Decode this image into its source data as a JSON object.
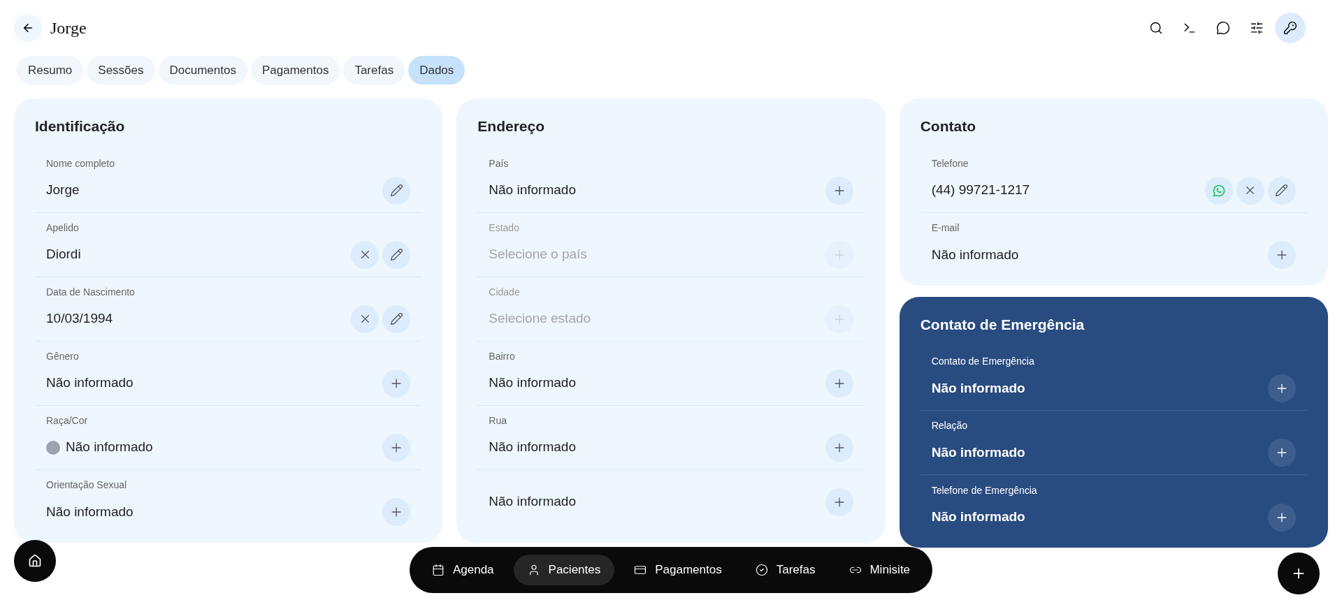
{
  "header": {
    "title": "Jorge",
    "tools": [
      {
        "kind": "search",
        "selected": false
      },
      {
        "kind": "terminal",
        "selected": false
      },
      {
        "kind": "chat",
        "selected": false
      },
      {
        "kind": "sliders",
        "selected": false
      },
      {
        "kind": "key",
        "selected": true
      }
    ]
  },
  "tabs": [
    {
      "label": "Resumo",
      "selected": false
    },
    {
      "label": "Sessões",
      "selected": false
    },
    {
      "label": "Documentos",
      "selected": false
    },
    {
      "label": "Pagamentos",
      "selected": false
    },
    {
      "label": "Tarefas",
      "selected": false
    },
    {
      "label": "Dados",
      "selected": true
    }
  ],
  "cards": [
    {
      "title": "Identificação",
      "kind": "light",
      "fields": [
        {
          "label": "Nome completo",
          "value": "Jorge",
          "disabled": false,
          "actions": [
            {
              "kind": "edit"
            }
          ]
        },
        {
          "label": "Apelido",
          "value": "Diordi",
          "disabled": false,
          "actions": [
            {
              "kind": "clear"
            },
            {
              "kind": "edit"
            }
          ]
        },
        {
          "label": "Data de Nascimento",
          "value": "10/03/1994",
          "disabled": false,
          "actions": [
            {
              "kind": "clear"
            },
            {
              "kind": "edit"
            }
          ]
        },
        {
          "label": "Gênero",
          "value": "Não informado",
          "disabled": false,
          "actions": [
            {
              "kind": "add"
            }
          ]
        },
        {
          "label": "Raça/Cor",
          "value": "Não informado",
          "disabled": false,
          "color": "#9ca3af",
          "actions": [
            {
              "kind": "add"
            }
          ]
        },
        {
          "label": "Orientação Sexual",
          "value": "Não informado",
          "disabled": false,
          "actions": [
            {
              "kind": "add"
            }
          ]
        }
      ]
    },
    {
      "title": "Endereço",
      "kind": "light",
      "fields": [
        {
          "label": "País",
          "value": "Não informado",
          "disabled": false,
          "actions": [
            {
              "kind": "add"
            }
          ]
        },
        {
          "label": "Estado",
          "placeholder": "Selecione o país",
          "disabled": true,
          "actions": [
            {
              "kind": "add"
            }
          ]
        },
        {
          "label": "Cidade",
          "placeholder": "Selecione estado",
          "disabled": true,
          "actions": [
            {
              "kind": "add"
            }
          ]
        },
        {
          "label": "Bairro",
          "value": "Não informado",
          "disabled": false,
          "actions": [
            {
              "kind": "add"
            }
          ]
        },
        {
          "label": "Rua",
          "value": "Não informado",
          "disabled": false,
          "actions": [
            {
              "kind": "add"
            }
          ]
        },
        {
          "value": "Não informado",
          "disabled": false,
          "actions": [
            {
              "kind": "add"
            }
          ]
        }
      ]
    },
    {
      "title": "Contato",
      "kind": "light",
      "fields": [
        {
          "label": "Telefone",
          "value": "(44) 99721-1217",
          "disabled": false,
          "actions": [
            {
              "kind": "whatsapp"
            },
            {
              "kind": "clear"
            },
            {
              "kind": "edit"
            }
          ]
        },
        {
          "label": "E-mail",
          "value": "Não informado",
          "disabled": false,
          "actions": [
            {
              "kind": "add"
            }
          ]
        }
      ]
    },
    {
      "title": "Contato de Emergência",
      "kind": "dark",
      "fields": [
        {
          "label": "Contato de Emergência",
          "value": "Não informado",
          "disabled": false,
          "actions": [
            {
              "kind": "add"
            }
          ]
        },
        {
          "label": "Relação",
          "value": "Não informado",
          "disabled": false,
          "actions": [
            {
              "kind": "add"
            }
          ]
        },
        {
          "label": "Telefone de Emergência",
          "value": "Não informado",
          "disabled": false,
          "actions": [
            {
              "kind": "add"
            }
          ]
        }
      ]
    }
  ],
  "dock": [
    {
      "kind": "calendar",
      "label": "Agenda",
      "selected": false
    },
    {
      "kind": "person",
      "label": "Pacientes",
      "selected": true
    },
    {
      "kind": "card",
      "label": "Pagamentos",
      "selected": false
    },
    {
      "kind": "check",
      "label": "Tarefas",
      "selected": false
    },
    {
      "kind": "link",
      "label": "Minisite",
      "selected": false
    }
  ]
}
